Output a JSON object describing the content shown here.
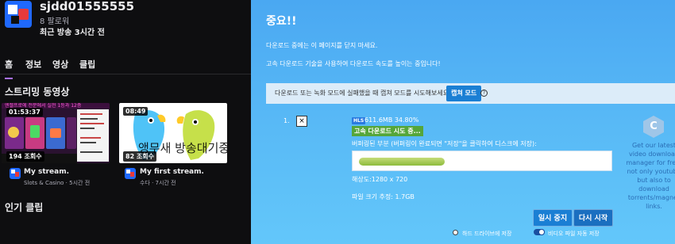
{
  "channel": {
    "name": "sjdd01555555",
    "followers": "8 팔로워",
    "last_stream": "최근 방송 3시간 전",
    "tabs": [
      "홈",
      "정보",
      "영상",
      "클립"
    ],
    "streaming_section_title": "스트리밍 동영상",
    "popular_clips_title": "인기 클립",
    "videos": [
      {
        "duration": "01:53:37",
        "views": "194 조회수",
        "title": "My stream.",
        "meta": "Slots & Casino · 5시간 전",
        "overlay_text": "엔젤프로에 전문에서 실천 1등과 12층"
      },
      {
        "duration": "08:49",
        "views": "82 조회수",
        "title": "My first stream.",
        "meta": "수다 · 7시간 전",
        "overlay_text": "앵무새 방송대기중"
      }
    ]
  },
  "panel": {
    "title": "중요!!",
    "line1": "다운로드 중에는 이 페이지를 닫지 마세요.",
    "line2": "고속 다운로드 기술을 사용하여 다운로드 속도를 높이는 중입니다!",
    "notice": "다운로드 또는 녹화 모드에 실패했을 때 캡쳐 모드를 시도해보세요:",
    "capture_button": "캡쳐 모드",
    "help_icon": "?",
    "item": {
      "index": "1.",
      "close_label": "×",
      "tag": "HLS",
      "size_progress": "611.6MB 34.80%",
      "progress_fraction": 0.348,
      "status": "고속 다운로드 시도 중...",
      "buffer_label": "버퍼링된 부분 (버퍼링이 완료되면 \"저장\"을 클릭하여 디스크에 저장):",
      "resolution": "해상도:1280 x 720",
      "estimated_size": "파일 크기 추정: 1.7GB"
    },
    "pause_button": "일시 중지",
    "resume_button": "다시 시작",
    "option_hdd": "하드 드라이브에 저장",
    "option_autosave": "비디오 파일 자동 저장",
    "promo_logo": "C",
    "promo_text": "Get our latest video download manager for free, not only youtube but also to download torrents/magnet links."
  },
  "colors": {
    "left_bg": "#0e0e10",
    "right_bg_top": "#4aa8f2",
    "accent_button": "#1a7fd4",
    "status_green": "#55a63a",
    "progress_fill": "#8dbb3c"
  }
}
